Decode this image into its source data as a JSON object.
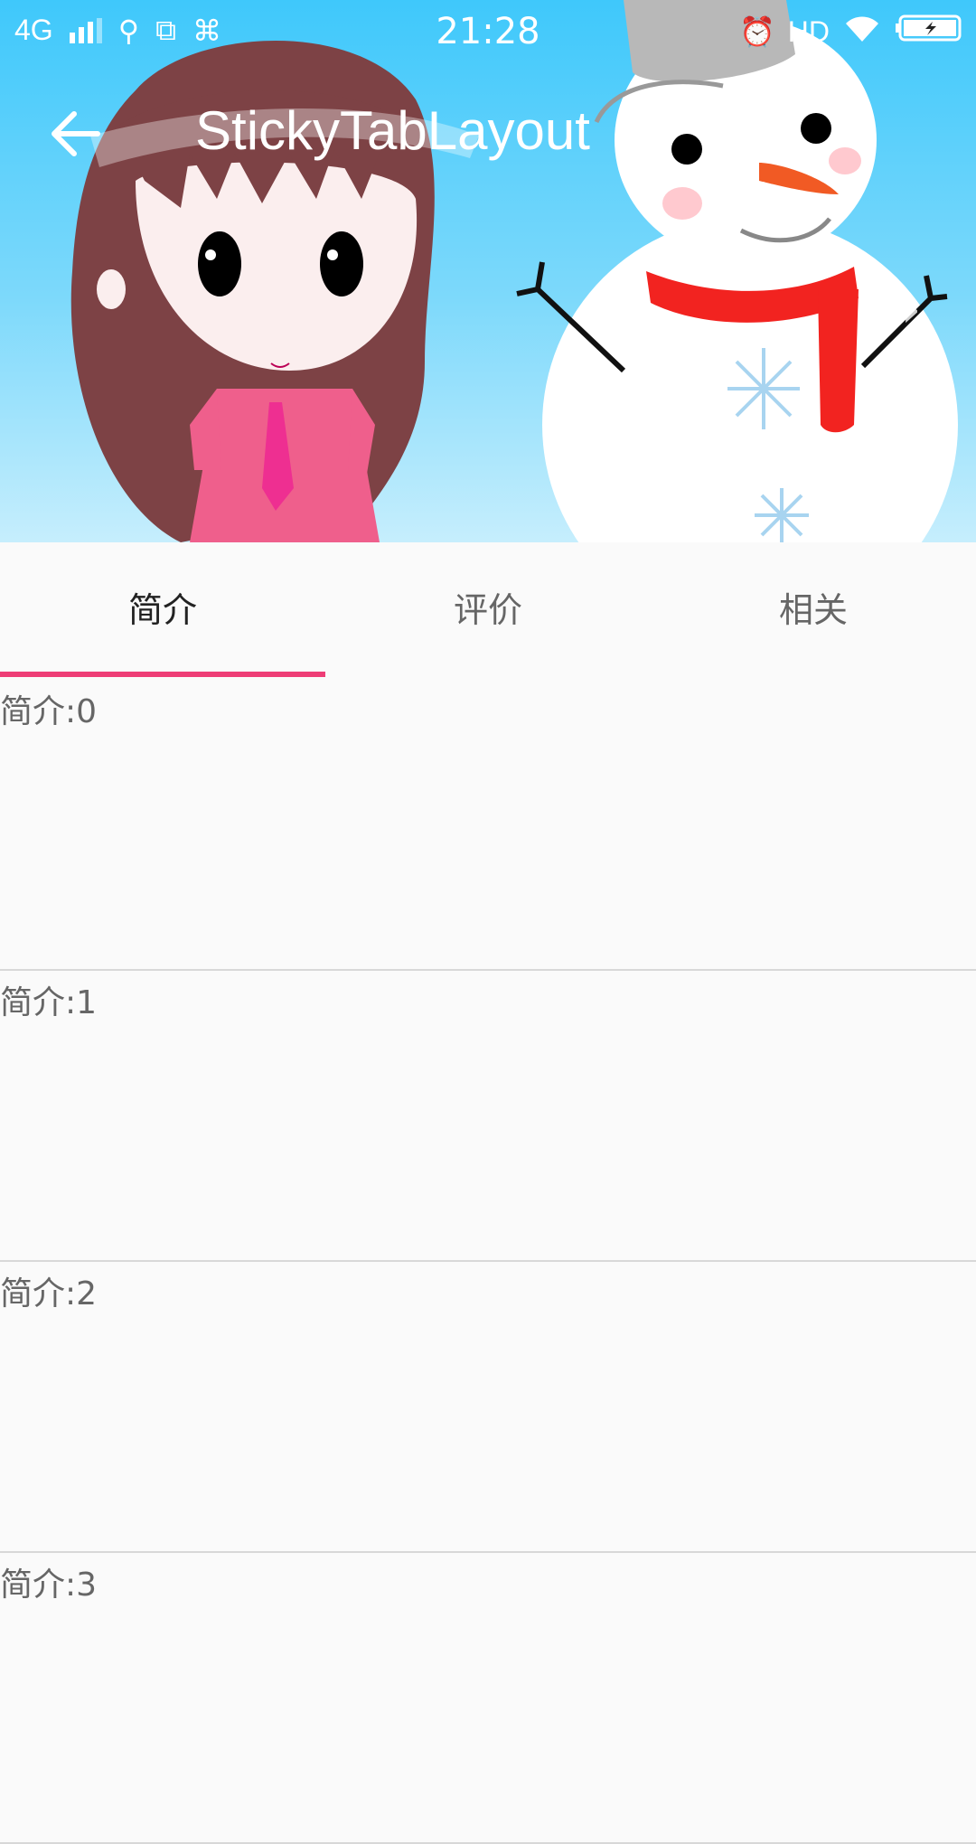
{
  "status_bar": {
    "network": "4G",
    "time": "21:28",
    "hd": "HD"
  },
  "toolbar": {
    "title": "StickyTabLayout"
  },
  "tabs": [
    {
      "label": "简介",
      "active": true
    },
    {
      "label": "评价",
      "active": false
    },
    {
      "label": "相关",
      "active": false
    }
  ],
  "list": [
    {
      "label": "简介:0"
    },
    {
      "label": "简介:1"
    },
    {
      "label": "简介:2"
    },
    {
      "label": "简介:3"
    }
  ],
  "colors": {
    "accent": "#ee3d76",
    "sky": "#3fc8fb"
  }
}
